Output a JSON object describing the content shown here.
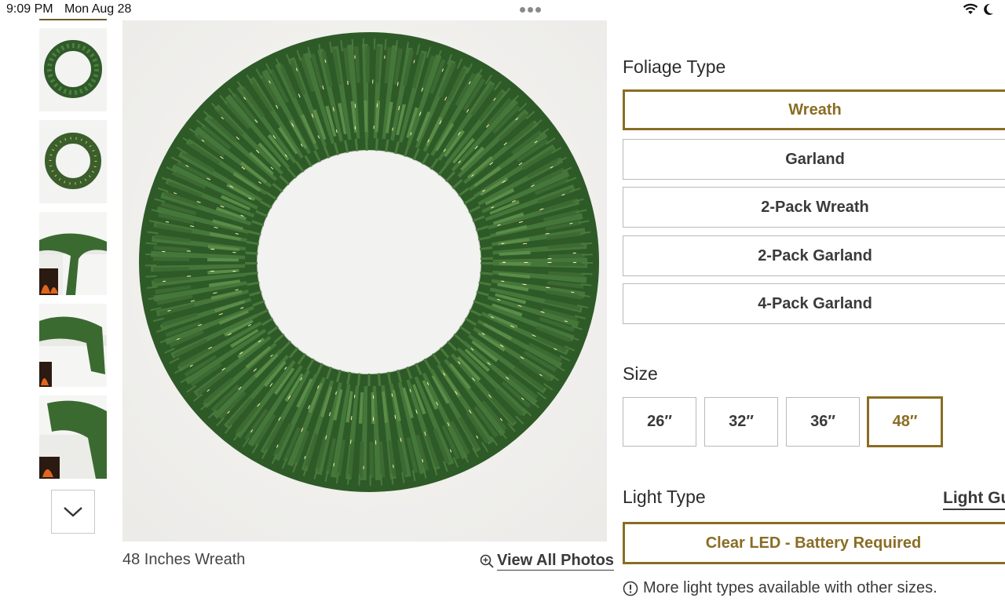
{
  "status_bar": {
    "time": "9:09 PM",
    "date": "Mon Aug 28",
    "icons": [
      "wifi-icon",
      "moon-icon"
    ]
  },
  "gallery": {
    "thumbnails": [
      {
        "name": "thumb-wreath-1",
        "icon": "wreath"
      },
      {
        "name": "thumb-wreath-2",
        "icon": "wreath"
      },
      {
        "name": "thumb-garland-fireplace-1",
        "icon": "garland"
      },
      {
        "name": "thumb-garland-fireplace-2",
        "icon": "garland"
      },
      {
        "name": "thumb-garland-fireplace-3",
        "icon": "garland"
      }
    ],
    "caption": "48 Inches Wreath",
    "view_all_label": "View All Photos"
  },
  "foliage": {
    "title": "Foliage Type",
    "options": [
      "Wreath",
      "Garland",
      "2-Pack Wreath",
      "2-Pack Garland",
      "4-Pack Garland"
    ],
    "selected": "Wreath"
  },
  "size": {
    "title": "Size",
    "options": [
      "26″",
      "32″",
      "36″",
      "48″"
    ],
    "selected": "48″"
  },
  "light": {
    "title": "Light Type",
    "guide_link": "Light Gui",
    "selected_option": "Clear LED - Battery Required",
    "notice": "More light types available with other sizes."
  },
  "colors": {
    "accent": "#8a6d23",
    "border": "#b9b9b9",
    "foliage_green": "#3f6b33"
  }
}
